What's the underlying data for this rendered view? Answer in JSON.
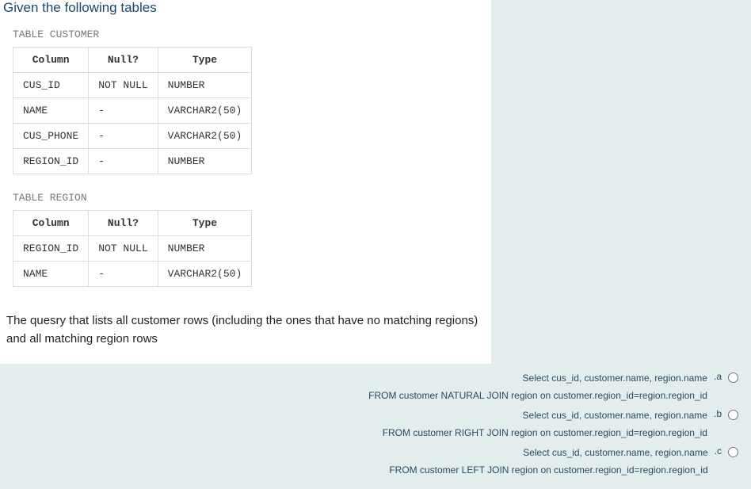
{
  "heading": "Given the following tables",
  "table1": {
    "title": "TABLE CUSTOMER",
    "headers": [
      "Column",
      "Null?",
      "Type"
    ],
    "rows": [
      [
        "CUS_ID",
        "NOT NULL",
        "NUMBER"
      ],
      [
        "NAME",
        "-",
        "VARCHAR2(50)"
      ],
      [
        "CUS_PHONE",
        "-",
        "VARCHAR2(50)"
      ],
      [
        "REGION_ID",
        "-",
        "NUMBER"
      ]
    ]
  },
  "table2": {
    "title": "TABLE REGION",
    "headers": [
      "Column",
      "Null?",
      "Type"
    ],
    "rows": [
      [
        "REGION_ID",
        "NOT NULL",
        "NUMBER"
      ],
      [
        "NAME",
        "-",
        "VARCHAR2(50)"
      ]
    ]
  },
  "question": "The quesry that lists all customer rows (including the ones that have no matching regions) and all matching region rows",
  "answers": [
    {
      "letter": ".a",
      "line1": "Select cus_id, customer.name, region.name",
      "line2": "FROM customer NATURAL JOIN region on customer.region_id=region.region_id"
    },
    {
      "letter": ".b",
      "line1": "Select cus_id, customer.name, region.name",
      "line2": "FROM customer RIGHT JOIN region on customer.region_id=region.region_id"
    },
    {
      "letter": ".c",
      "line1": "Select cus_id, customer.name, region.name",
      "line2": "FROM customer LEFT JOIN region on customer.region_id=region.region_id"
    }
  ]
}
